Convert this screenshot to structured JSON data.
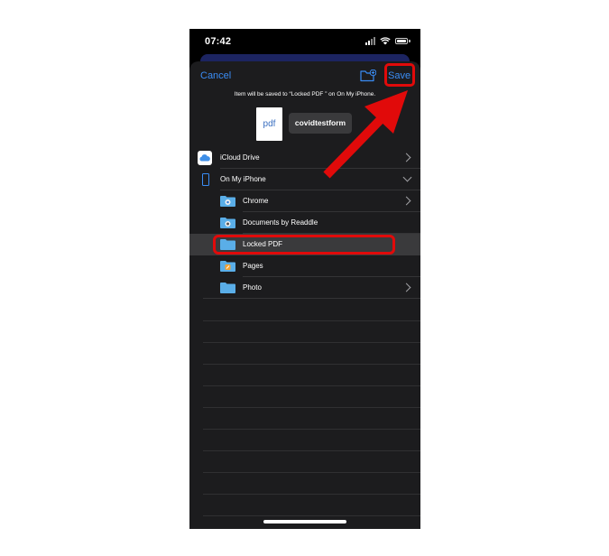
{
  "status_bar": {
    "time": "07:42"
  },
  "header": {
    "cancel_label": "Cancel",
    "save_label": "Save",
    "save_info": "Item will be saved to “Locked PDF ” on On My iPhone."
  },
  "document": {
    "thumbnail_label": "pdf",
    "filename": "covidtestform"
  },
  "locations": [
    {
      "label": "iCloud Drive",
      "icon": "cloud-icon",
      "chevron": "right"
    },
    {
      "label": "On My iPhone",
      "icon": "iphone-icon",
      "chevron": "down"
    }
  ],
  "folders": [
    {
      "label": "Chrome",
      "icon": "chrome-folder-icon",
      "chevron": "right"
    },
    {
      "label": "Documents by Readdle",
      "icon": "readdle-folder-icon",
      "chevron": ""
    },
    {
      "label": "Locked PDF",
      "icon": "folder-icon",
      "chevron": "",
      "selected": true
    },
    {
      "label": "Pages",
      "icon": "pages-folder-icon",
      "chevron": ""
    },
    {
      "label": "Photo",
      "icon": "folder-icon",
      "chevron": "right"
    }
  ],
  "colors": {
    "accent": "#3a8cf4",
    "highlight": "#e10a0a",
    "sheet_bg": "#1c1c1e",
    "selected_row": "#3a3a3c",
    "folder": "#5aaee8"
  }
}
